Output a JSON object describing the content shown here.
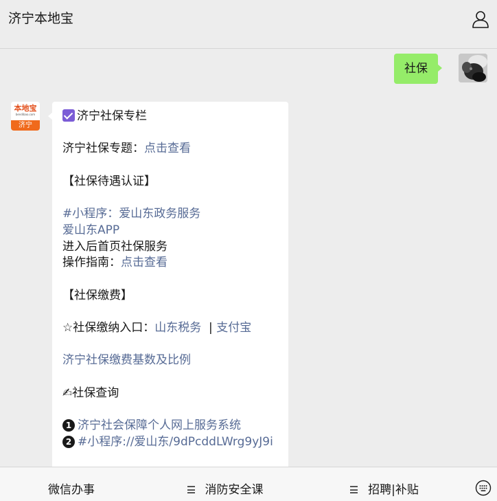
{
  "header": {
    "title": "济宁本地宝",
    "user_icon": "user-icon"
  },
  "my_message": {
    "text": "社保"
  },
  "their_avatar": {
    "logo_text": "本地宝",
    "logo_sub": "bendibao.com",
    "city": "济宁"
  },
  "article": {
    "line1": "济宁社保专栏",
    "line2_label": "济宁社保专题：",
    "line2_link": "点击查看",
    "section1": "【社保待遇认证】",
    "mini_program": "#小程序：爱山东政务服务",
    "app": "爱山东APP",
    "enter": "进入后首页社保服务",
    "guide_label": "操作指南：",
    "guide_link": "点击查看",
    "section2": "【社保缴费】",
    "pay_label": "☆社保缴纳入口：",
    "pay_link1": "山东税务",
    "pay_sep": "  | ",
    "pay_link2": "支付宝",
    "base_link": "济宁社保缴费基数及比例",
    "query_emoji": "✍",
    "query_title": "社保查询",
    "item1_num": "1",
    "item1_link": "济宁社会保障个人网上服务系统",
    "item2_num": "2",
    "item2_link": "#小程序://爱山东/9dPcddLWrg9yJ9i"
  },
  "footer": {
    "menu1": "微信办事",
    "menu2": "消防安全课",
    "menu3": "招聘|补贴",
    "keyboard_icon": "keyboard-icon"
  },
  "colors": {
    "link": "#576b95",
    "my_bubble": "#95ec69",
    "background": "#ededed"
  }
}
